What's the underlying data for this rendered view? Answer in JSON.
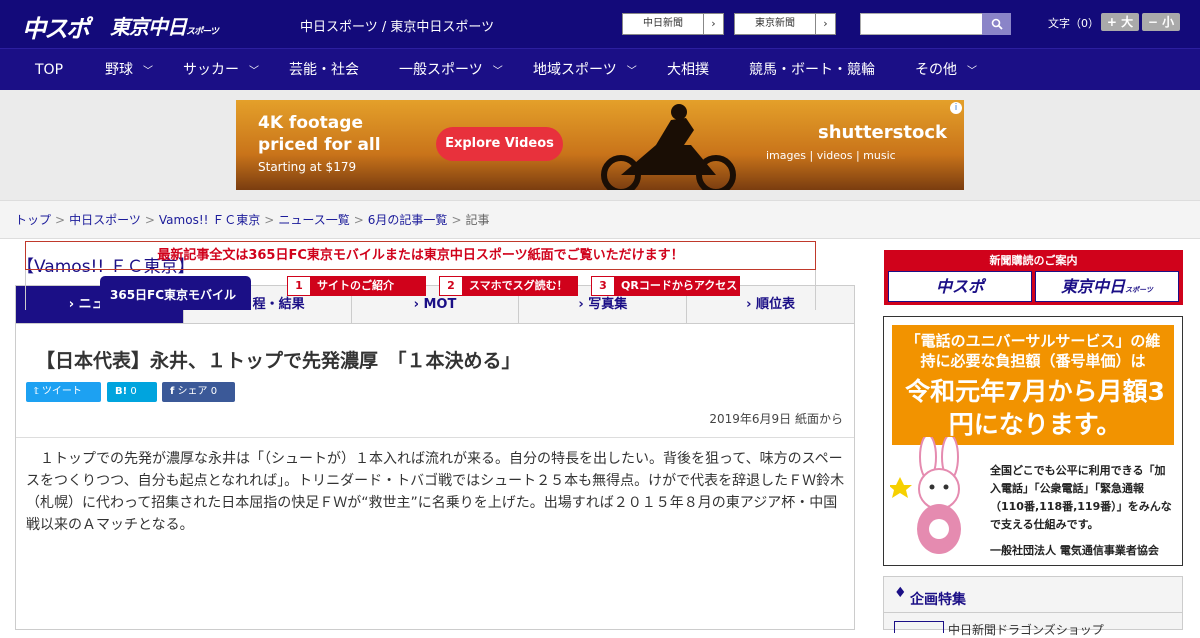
{
  "header": {
    "logo_chuspo": "中スポ",
    "logo_tokyo": "東京中日",
    "logo_tokyo_small": "スポーツ",
    "site_title": "中日スポーツ / 東京中日スポーツ",
    "btn_chunichi": "中日新聞",
    "btn_tokyo": "東京新聞",
    "font_size_label": "文字（0）",
    "font_plus": "+ 大",
    "font_minus": "− 小"
  },
  "nav": {
    "items": [
      "TOP",
      "野球",
      "サッカー",
      "芸能・社会",
      "一般スポーツ",
      "地域スポーツ",
      "大相撲",
      "競馬・ボート・競輪",
      "その他"
    ]
  },
  "ad": {
    "line1": "4K footage",
    "line2": "priced for all",
    "line3": "Starting at $179",
    "cta": "Explore Videos",
    "brand": "shutterstock",
    "brand_sub": "images  |  videos  |  music"
  },
  "breadcrumb": [
    "トップ",
    "中日スポーツ",
    "Vamos!! ＦＣ東京",
    "ニュース一覧",
    "6月の記事一覧",
    "記事"
  ],
  "section_title": "【Vamos!! ＦＣ東京】",
  "tabs": [
    "ニュース",
    "日程・結果",
    "MOT",
    "写真集",
    "順位表"
  ],
  "article": {
    "headline": "【日本代表】永井、１トップで先発濃厚　「１本決める」",
    "share_tweet": "ツイート",
    "share_hatena": "0",
    "share_facebook": "シェア 0",
    "date": "2019年6月9日 紙面から",
    "body": "１トップでの先発が濃厚な永井は「（シュートが）１本入れば流れが来る。自分の特長を出したい。背後を狙って、味方のスペースをつくりつつ、自分も起点となれれば」。トリニダード・トバゴ戦ではシュート２５本も無得点。けがで代表を辞退したＦＷ鈴木（札幌）に代わって招集された日本屈指の快足ＦＷが“救世主”に名乗りを上げた。出場すれば２０１５年８月の東アジア杯・中国戦以来のＡマッチとなる。",
    "promo": "最新記事全文は365日FC東京モバイルまたは東京中日スポーツ紙面でご覧いただけます！",
    "mobile_label": "365日FC東京モバイル",
    "steps": [
      {
        "num": "1",
        "label": "サイトのご紹介"
      },
      {
        "num": "2",
        "label": "スマホでスグ読む！"
      },
      {
        "num": "3",
        "label": "QRコードからアクセス"
      }
    ]
  },
  "sidebar": {
    "subscribe_label": "新聞購読のご案内",
    "sub_logo1": "中スポ",
    "sub_logo2": "東京中日",
    "sub_logo2_small": "スポーツ",
    "uni_q": "「電話のユニバーサルサービス」の維持に必要な負担額（番号単価）は",
    "uni_big": "令和元年7月から月額3円になります。",
    "uni_desc": "全国どこでも公平に利用できる「加入電話」「公衆電話」「緊急通報（110番,118番,119番）」をみんなで支える仕組みです。",
    "uni_org": "一般社団法人 電気通信事業者協会",
    "special_title": "企画特集",
    "special_item": "中日新聞ドラゴンズショップ"
  },
  "colors": {
    "brand_navy": "#130a7a",
    "accent_red": "#d0021b",
    "uni_orange": "#f29300"
  }
}
